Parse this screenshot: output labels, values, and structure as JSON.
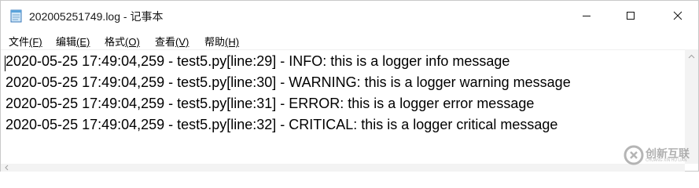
{
  "window": {
    "title": "202005251749.log - 记事本"
  },
  "controls": {
    "minimize_icon": "minimize-icon",
    "maximize_icon": "maximize-icon",
    "close_icon": "close-icon"
  },
  "menu": [
    {
      "label": "文件",
      "key": "(F)"
    },
    {
      "label": "编辑",
      "key": "(E)"
    },
    {
      "label": "格式",
      "key": "(O)"
    },
    {
      "label": "查看",
      "key": "(V)"
    },
    {
      "label": "帮助",
      "key": "(H)"
    }
  ],
  "editor": {
    "lines": [
      "2020-05-25 17:49:04,259 - test5.py[line:29] - INFO: this is a logger info message",
      "2020-05-25 17:49:04,259 - test5.py[line:30] - WARNING: this is a logger warning message",
      "2020-05-25 17:49:04,259 - test5.py[line:31] - ERROR: this is a logger error message",
      "2020-05-25 17:49:04,259 - test5.py[line:32] - CRITICAL: this is a logger critical message"
    ]
  },
  "watermark": {
    "text": "创新互联",
    "subtext": "CHUANG XIN HU LIAN"
  }
}
